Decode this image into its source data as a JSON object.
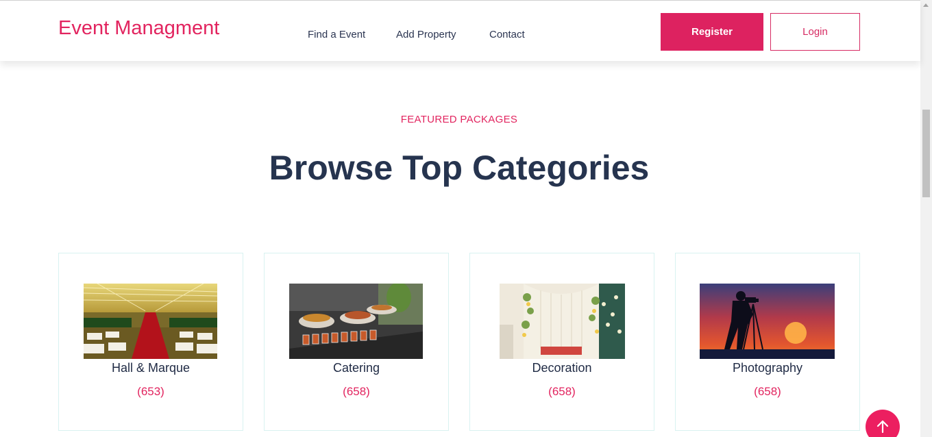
{
  "header": {
    "brand": "Event Managment",
    "nav": [
      "Find a Event",
      "Add Property",
      "Contact"
    ],
    "register_label": "Register",
    "login_label": "Login"
  },
  "section": {
    "eyebrow": "FEATURED PACKAGES",
    "title": "Browse Top Categories"
  },
  "categories": [
    {
      "name": "Hall & Marque",
      "count": "(653)",
      "icon": "hall-photo"
    },
    {
      "name": "Catering",
      "count": "(658)",
      "icon": "catering-photo"
    },
    {
      "name": "Decoration",
      "count": "(658)",
      "icon": "decoration-photo"
    },
    {
      "name": "Photography",
      "count": "(658)",
      "icon": "photography-photo"
    }
  ],
  "colors": {
    "accent": "#e2245f",
    "heading": "#26344f",
    "card_border": "#d8f2f1"
  },
  "back_to_top_icon": "arrow-up-icon"
}
